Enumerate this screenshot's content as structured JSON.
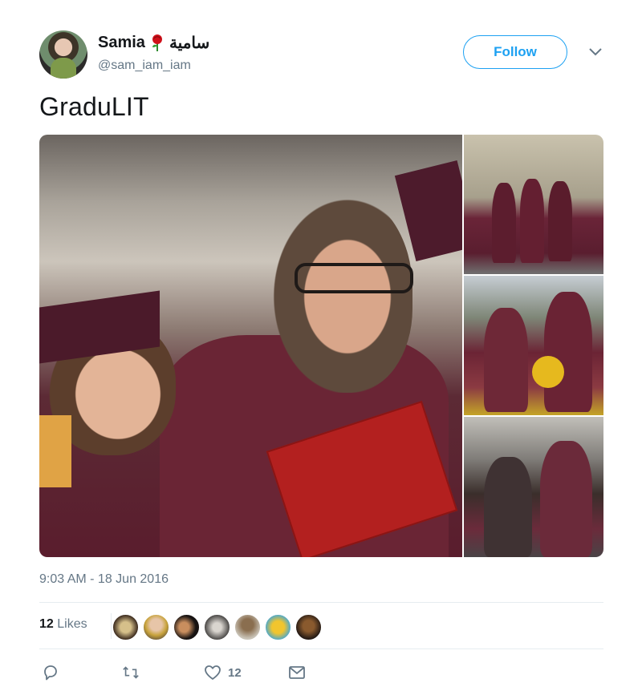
{
  "user": {
    "display_name": "Samia",
    "name_suffix": "سامية",
    "handle": "@sam_iam_iam"
  },
  "follow_label": "Follow",
  "tweet": {
    "text": "GraduLIT",
    "timestamp": "9:03 AM - 18 Jun 2016"
  },
  "likes": {
    "count": "12",
    "label": "Likes"
  },
  "actions": {
    "like_count": "12"
  },
  "colors": {
    "accent": "#1da1f2",
    "muted": "#657786",
    "text": "#14171a",
    "divider": "#e6ecf0"
  },
  "icons": [
    "rose-icon",
    "chevron-down-icon",
    "reply-icon",
    "retweet-icon",
    "heart-icon",
    "mail-icon"
  ]
}
